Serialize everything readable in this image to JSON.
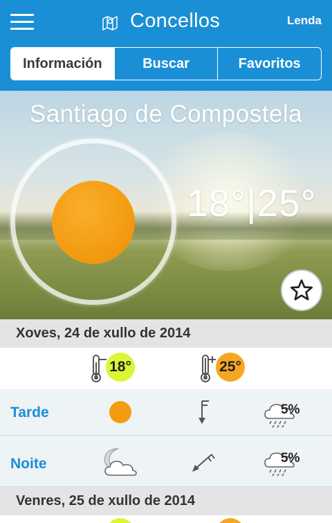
{
  "header": {
    "title": "Concellos",
    "lenda_label": "Lenda",
    "bg_color": "#1a8fd6"
  },
  "tabs": [
    {
      "label": "Información",
      "active": true
    },
    {
      "label": "Buscar",
      "active": false
    },
    {
      "label": "Favoritos",
      "active": false
    }
  ],
  "hero": {
    "city": "Santiago de Compostela",
    "temp_min": "18°",
    "temp_separator": "|",
    "temp_max": "25°",
    "condition_icon": "sun-icon",
    "favorite_icon": "star-outline-icon"
  },
  "days": [
    {
      "date_label": "Xoves, 24 de xullo de 2014",
      "min_temp": "18°",
      "max_temp": "25°",
      "periods": [
        {
          "label": "Tarde",
          "sky_icon": "sun-icon",
          "wind_icon": "wind-arrow-south-icon",
          "rain": "5%"
        },
        {
          "label": "Noite",
          "sky_icon": "moon-cloud-icon",
          "wind_icon": "wind-arrow-southwest-icon",
          "rain": "5%"
        }
      ]
    },
    {
      "date_label": "Venres, 25 de xullo de 2014"
    }
  ],
  "colors": {
    "accent": "#1a8fd6",
    "sun": "#f39c12",
    "min_badge": "#ddf533",
    "max_badge": "#f6a623"
  }
}
